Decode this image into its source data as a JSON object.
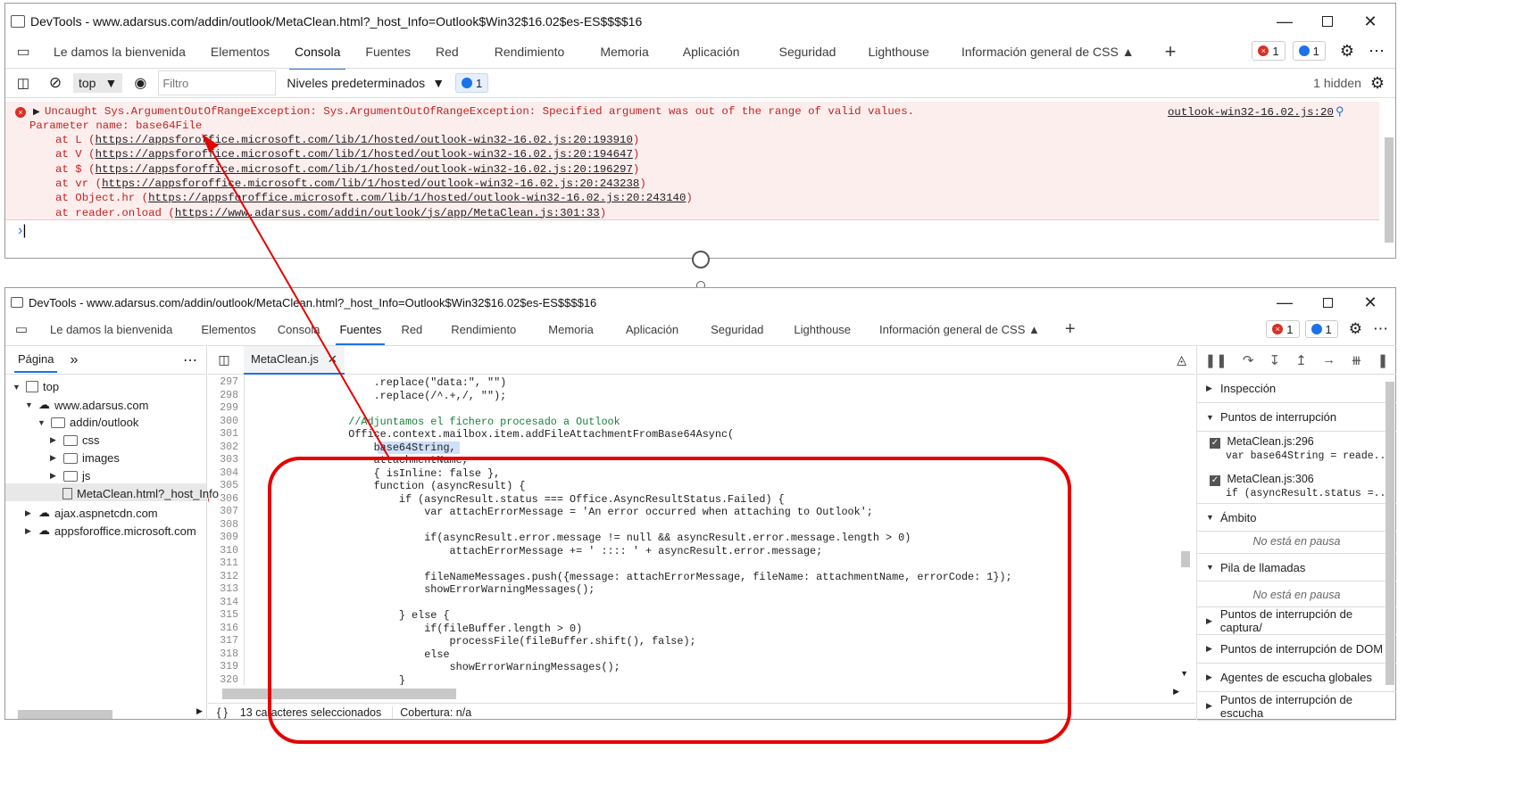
{
  "top_window": {
    "title": "DevTools - www.adarsus.com/addin/outlook/MetaClean.html?_host_Info=Outlook$Win32$16.02$es-ES$$$$16",
    "tabs": [
      "Le damos la bienvenida",
      "Elementos",
      "Consola",
      "Fuentes",
      "Red",
      "Rendimiento",
      "Memoria",
      "Aplicación",
      "Seguridad",
      "Lighthouse",
      "Información general de CSS"
    ],
    "active_tab": "Consola",
    "error_count": "1",
    "info_count": "1",
    "console_toolbar": {
      "context": "top",
      "filter_placeholder": "Filtro",
      "levels": "Niveles predeterminados",
      "issues_count": "1",
      "hidden": "1 hidden"
    },
    "error": {
      "message": "Uncaught Sys.ArgumentOutOfRangeException: Sys.ArgumentOutOfRangeException: Specified argument was out of the range of valid values.",
      "param": "Parameter name: base64File",
      "source": "outlook-win32-16.02.js:20",
      "stack": [
        {
          "prefix": "at L (",
          "url": "https://appsforoffice.microsoft.com/lib/1/hosted/outlook-win32-16.02.js:20:193910",
          "suffix": ")"
        },
        {
          "prefix": "at V (",
          "url": "https://appsforoffice.microsoft.com/lib/1/hosted/outlook-win32-16.02.js:20:194647",
          "suffix": ")"
        },
        {
          "prefix": "at $ (",
          "url": "https://appsforoffice.microsoft.com/lib/1/hosted/outlook-win32-16.02.js:20:196297",
          "suffix": ")"
        },
        {
          "prefix": "at vr (",
          "url": "https://appsforoffice.microsoft.com/lib/1/hosted/outlook-win32-16.02.js:20:243238",
          "suffix": ")"
        },
        {
          "prefix": "at Object.hr (",
          "url": "https://appsforoffice.microsoft.com/lib/1/hosted/outlook-win32-16.02.js:20:243140",
          "suffix": ")"
        },
        {
          "prefix": "at reader.onload (",
          "url": "https://www.adarsus.com/addin/outlook/js/app/MetaClean.js:301:33",
          "suffix": ")"
        }
      ]
    },
    "prompt": "›"
  },
  "bottom_window": {
    "title": "DevTools - www.adarsus.com/addin/outlook/MetaClean.html?_host_Info=Outlook$Win32$16.02$es-ES$$$$16",
    "tabs": [
      "Le damos la bienvenida",
      "Elementos",
      "Consola",
      "Fuentes",
      "Red",
      "Rendimiento",
      "Memoria",
      "Aplicación",
      "Seguridad",
      "Lighthouse",
      "Información general de CSS"
    ],
    "active_tab": "Fuentes",
    "error_count": "1",
    "info_count": "1",
    "navigator": {
      "tab": "Página",
      "more": "»",
      "items": [
        "top",
        "www.adarsus.com",
        "addin/outlook",
        "css",
        "images",
        "js",
        "MetaClean.html?_host_Info",
        "ajax.aspnetcdn.com",
        "appsforoffice.microsoft.com"
      ]
    },
    "editor_tab": "MetaClean.js",
    "code": [
      {
        "n": "297",
        "t": "                    .replace(\"data:\", \"\")"
      },
      {
        "n": "298",
        "t": "                    .replace(/^.+,/, \"\");"
      },
      {
        "n": "299",
        "t": ""
      },
      {
        "n": "300",
        "t": "                //Adjuntamos el fichero procesado a Outlook"
      },
      {
        "n": "301",
        "t": "                Office.context.mailbox.item.addFileAttachmentFromBase64Async("
      },
      {
        "n": "302",
        "t": "                    base64String,"
      },
      {
        "n": "303",
        "t": "                    attachmentName,"
      },
      {
        "n": "304",
        "t": "                    { isInline: false },"
      },
      {
        "n": "305",
        "t": "                    function (asyncResult) {"
      },
      {
        "n": "306",
        "t": "                        if (asyncResult.status === Office.AsyncResultStatus.Failed) {"
      },
      {
        "n": "307",
        "t": "                            var attachErrorMessage = 'An error occurred when attaching to Outlook';"
      },
      {
        "n": "308",
        "t": ""
      },
      {
        "n": "309",
        "t": "                            if(asyncResult.error.message != null && asyncResult.error.message.length > 0)"
      },
      {
        "n": "310",
        "t": "                                attachErrorMessage += ' :::: ' + asyncResult.error.message;"
      },
      {
        "n": "311",
        "t": ""
      },
      {
        "n": "312",
        "t": "                            fileNameMessages.push({message: attachErrorMessage, fileName: attachmentName, errorCode: 1});"
      },
      {
        "n": "313",
        "t": "                            showErrorWarningMessages();"
      },
      {
        "n": "314",
        "t": ""
      },
      {
        "n": "315",
        "t": "                        } else {"
      },
      {
        "n": "316",
        "t": "                            if(fileBuffer.length > 0)"
      },
      {
        "n": "317",
        "t": "                                processFile(fileBuffer.shift(), false);"
      },
      {
        "n": "318",
        "t": "                            else"
      },
      {
        "n": "319",
        "t": "                                showErrorWarningMessages();"
      },
      {
        "n": "320",
        "t": "                        }"
      }
    ],
    "status": {
      "braces": "{ }",
      "selected": "13 caracteres seleccionados",
      "coverage": "Cobertura: n/a"
    },
    "debugger": {
      "sections": {
        "inspeccion": "Inspección",
        "breakpoints": "Puntos de interrupción",
        "scope": "Ámbito",
        "callstack": "Pila de llamadas",
        "capture_bp": "Puntos de interrupción de captura/",
        "dom_bp": "Puntos de interrupción de DOM",
        "global_listeners": "Agentes de escucha globales",
        "event_bp": "Puntos de interrupción de escucha"
      },
      "breakpoints": [
        {
          "file": "MetaClean.js:296",
          "code": "var base64String = reade..."
        },
        {
          "file": "MetaClean.js:306",
          "code": "if (asyncResult.status =..."
        }
      ],
      "not_paused": "No está en pausa"
    }
  },
  "colors": {
    "error_bg": "#fdeeee",
    "error_text": "#c5221f",
    "accent": "#1a73e8",
    "annotation": "#e60000"
  }
}
